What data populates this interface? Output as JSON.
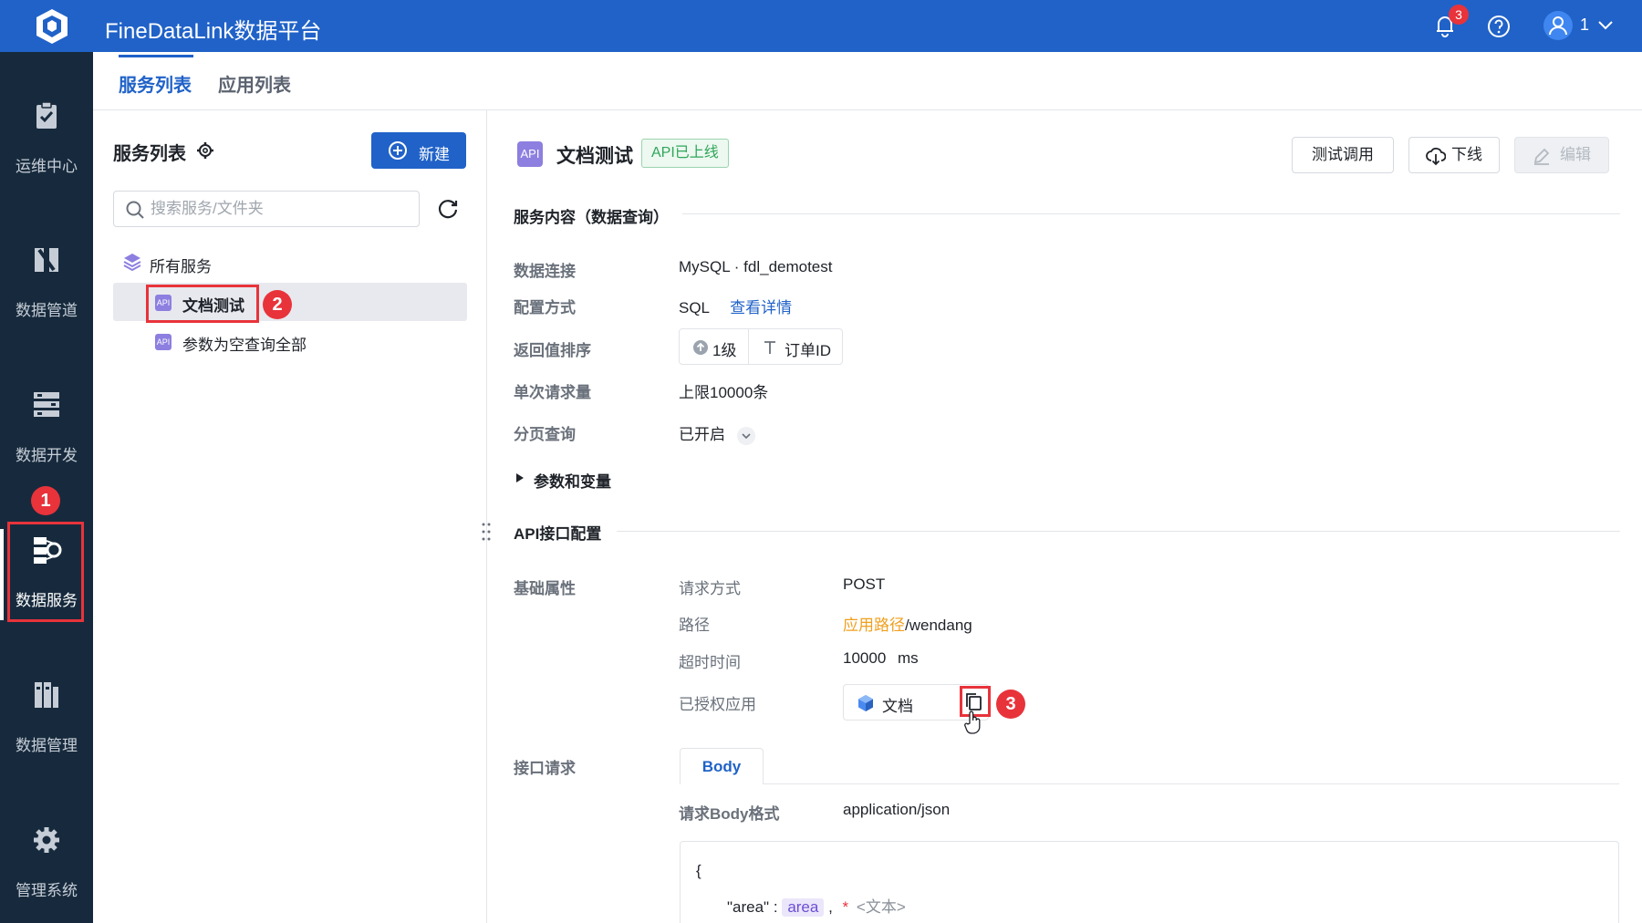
{
  "app": {
    "title": "FineDataLink数据平台",
    "notification_count": "3",
    "user": "1"
  },
  "sidebar": {
    "items": [
      {
        "label": "运维中心",
        "icon": "clipboard-check-icon"
      },
      {
        "label": "数据管道",
        "icon": "pipeline-icon"
      },
      {
        "label": "数据开发",
        "icon": "dev-icon"
      },
      {
        "label": "数据服务",
        "icon": "data-service-icon"
      },
      {
        "label": "数据管理",
        "icon": "data-management-icon"
      },
      {
        "label": "管理系统",
        "icon": "gear-icon"
      }
    ]
  },
  "annotations": {
    "one": "1",
    "two": "2",
    "three": "3"
  },
  "tabs": [
    {
      "label": "服务列表"
    },
    {
      "label": "应用列表"
    }
  ],
  "left_panel": {
    "title": "服务列表",
    "new_button": "新建",
    "search_placeholder": "搜索服务/文件夹",
    "tree_root": "所有服务",
    "items": [
      {
        "label": "文档测试",
        "icon": "API"
      },
      {
        "label": "参数为空查询全部",
        "icon": "API"
      }
    ]
  },
  "detail": {
    "api_badge": "API",
    "title": "文档测试",
    "status": "API已上线",
    "buttons": {
      "test": "测试调用",
      "offline": "下线",
      "edit": "编辑"
    },
    "service_section": "服务内容（数据查询）",
    "fields": {
      "connection_label": "数据连接",
      "connection_value": "MySQL · fdl_demotest",
      "config_label": "配置方式",
      "config_value": "SQL",
      "config_link": "查看详情",
      "sort_label": "返回值排序",
      "sort_level": "1级",
      "sort_field": "订单ID",
      "limit_label": "单次请求量",
      "limit_value": "上限10000条",
      "paging_label": "分页查询",
      "paging_value": "已开启"
    },
    "params_section": "参数和变量",
    "api_section": "API接口配置",
    "basic": {
      "label": "基础属性",
      "method_label": "请求方式",
      "method_value": "POST",
      "path_label": "路径",
      "path_prefix": "应用路径",
      "path_value": "/wendang",
      "timeout_label": "超时时间",
      "timeout_value": "10000",
      "timeout_unit": "ms",
      "auth_label": "已授权应用",
      "auth_app": "文档"
    },
    "request": {
      "label": "接口请求",
      "body_tab": "Body",
      "format_label": "请求Body格式",
      "format_value": "application/json",
      "code_open": "{",
      "code_key": "\"area\"",
      "code_colon": ":",
      "code_var": "area",
      "code_comma": ",",
      "code_star": "*",
      "code_type": "<文本>"
    }
  },
  "colors": {
    "primary": "#2062c8",
    "sidebar": "#172a3d",
    "danger": "#e8333b",
    "success": "#2fa65a",
    "accent_orange": "#f0a020"
  }
}
